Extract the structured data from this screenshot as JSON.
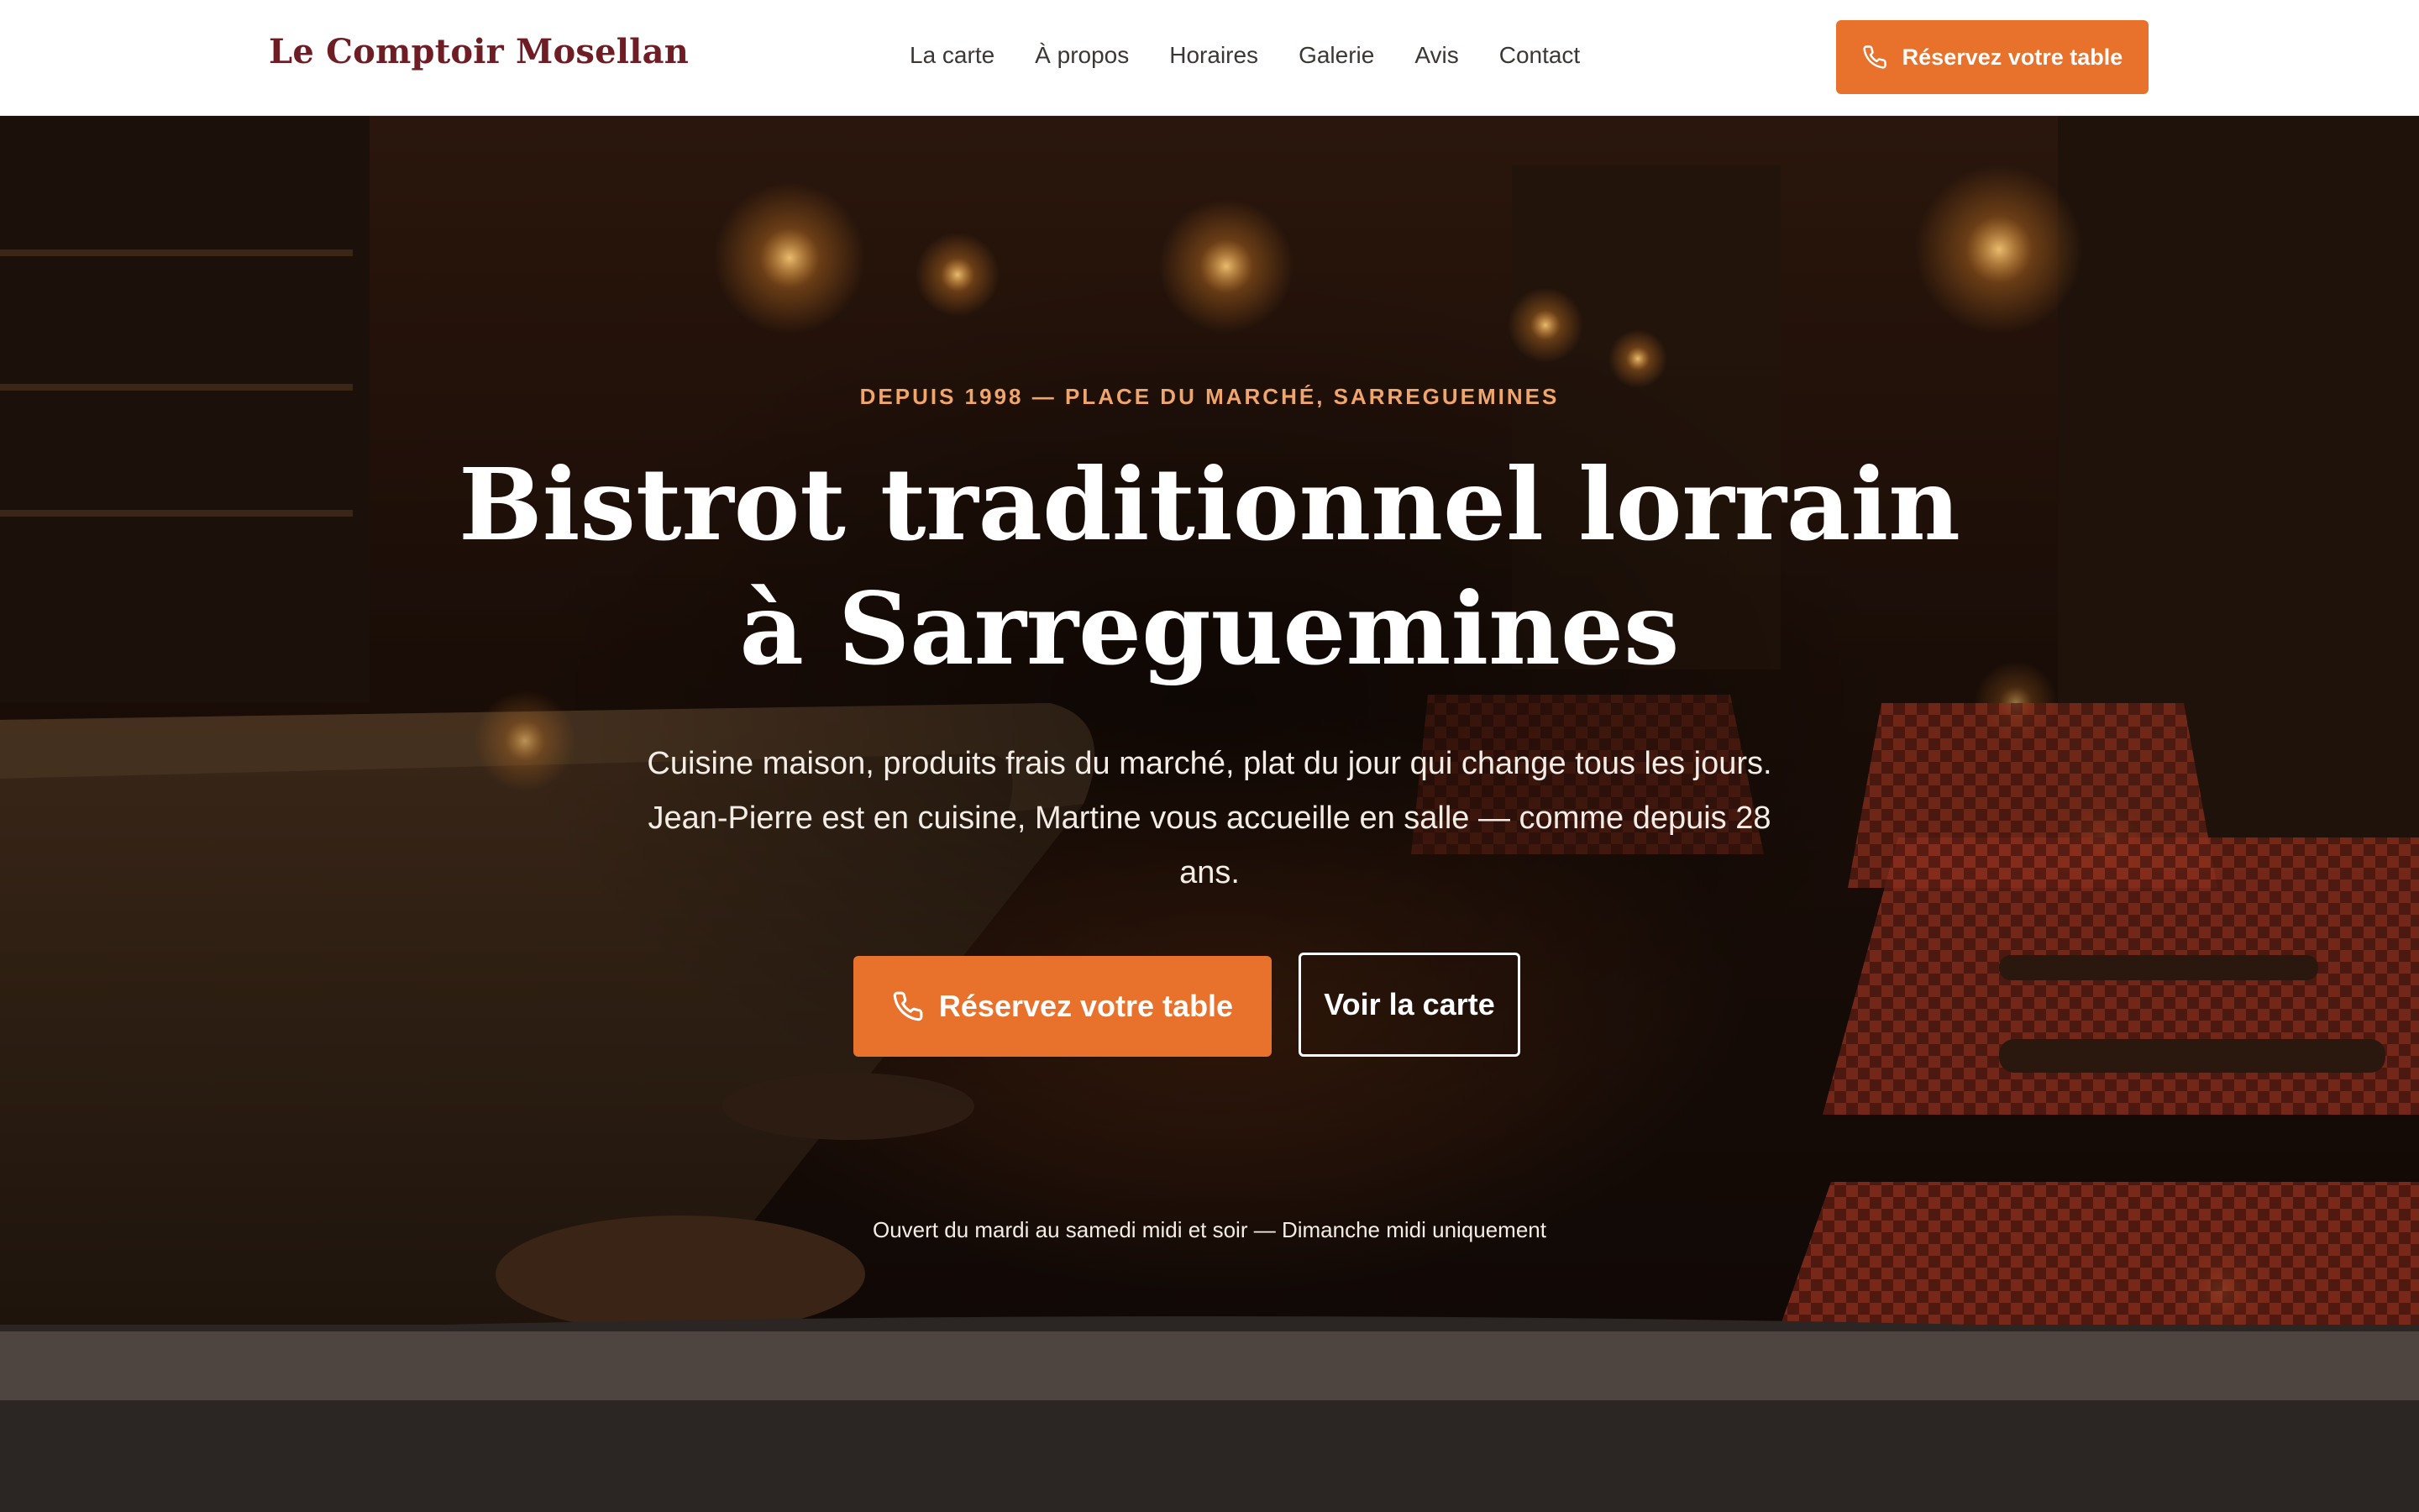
{
  "nav": {
    "brand": "Le Comptoir Mosellan",
    "links": [
      "La carte",
      "À propos",
      "Horaires",
      "Galerie",
      "Avis",
      "Contact"
    ],
    "cta_label": "Réservez votre table"
  },
  "hero": {
    "eyebrow": "DEPUIS 1998 — PLACE DU MARCHÉ, SARREGUEMINES",
    "title": "Bistrot traditionnel lorrain à Sarreguemines",
    "lead": "Cuisine maison, produits frais du marché, plat du jour qui change tous les jours. Jean-Pierre est en cuisine, Martine vous accueille en salle — comme depuis 28 ans.",
    "primary_cta": "Réservez votre table",
    "secondary_cta": "Voir la carte",
    "hours": "Ouvert du mardi au samedi midi et soir — Dimanche midi uniquement"
  },
  "icons": {
    "cta_icon": "phone-icon"
  },
  "colors": {
    "brand": "#6e1d24",
    "accent": "#e8712b",
    "eyebrow": "#f0a66a",
    "footer_band": "#4e4540",
    "footer_dark": "#2b2623"
  }
}
